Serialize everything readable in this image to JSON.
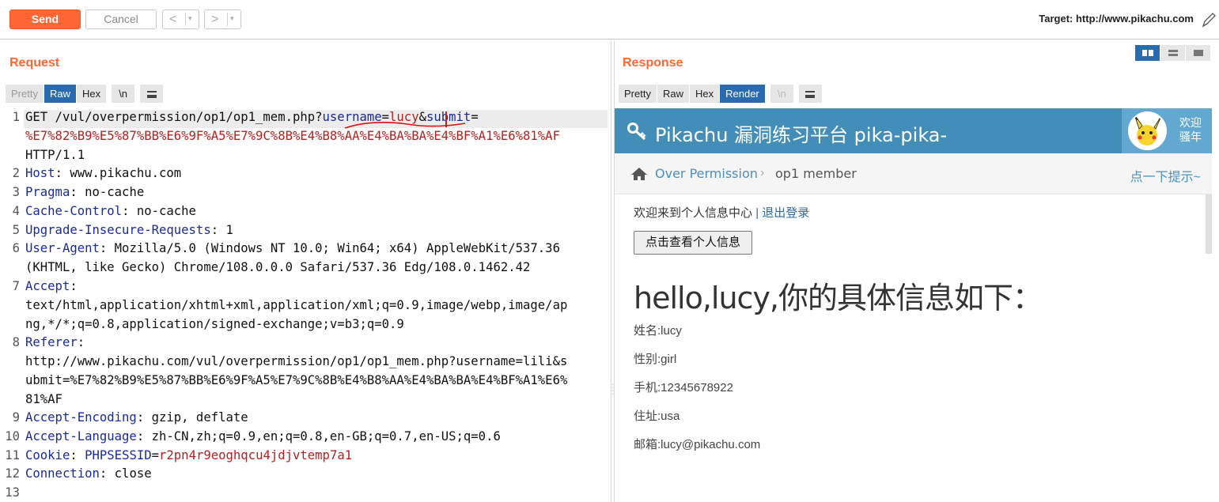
{
  "toolbar": {
    "send_label": "Send",
    "cancel_label": "Cancel",
    "back_label": "<",
    "forward_label": ">",
    "dropdown_glyph": "▾",
    "target_label": "Target: http://www.pikachu.com"
  },
  "request": {
    "title": "Request",
    "tabs": [
      "Pretty",
      "Raw",
      "Hex",
      "\\n"
    ],
    "active_tab": "Raw",
    "line_numbers": [
      "1",
      "2",
      "3",
      "4",
      "5",
      "6",
      "7",
      "8",
      "9",
      "10",
      "11",
      "12",
      "13"
    ],
    "lines": {
      "l1_method_path": "GET /vul/overpermission/op1/op1_mem.php?",
      "l1_username_key": "username",
      "l1_eq1": "=",
      "l1_username_val": "lucy",
      "l1_amp": "&",
      "l1_submit_key": "submit",
      "l1_eq2": "=",
      "l1_encoded": "%E7%82%B9%E5%87%BB%E6%9F%A5%E7%9C%8B%E4%B8%AA%E4%BA%BA%E4%BF%A1%E6%81%AF",
      "l1_version": "HTTP/1.1",
      "l2_key": "Host",
      "l2_val": ": www.pikachu.com",
      "l3_key": "Pragma",
      "l3_val": ": no-cache",
      "l4_key": "Cache-Control",
      "l4_val": ": no-cache",
      "l5_key": "Upgrade-Insecure-Requests",
      "l5_val": ": 1",
      "l6_key": "User-Agent",
      "l6_val": ": Mozilla/5.0 (Windows NT 10.0; Win64; x64) AppleWebKit/537.36",
      "l6_cont": "(KHTML, like Gecko) Chrome/108.0.0.0 Safari/537.36 Edg/108.0.1462.42",
      "l7_key": "Accept",
      "l7_val": ":",
      "l7_cont1": "text/html,application/xhtml+xml,application/xml;q=0.9,image/webp,image/ap",
      "l7_cont2": "ng,*/*;q=0.8,application/signed-exchange;v=b3;q=0.9",
      "l8_key": "Referer",
      "l8_val": ":",
      "l8_cont1": "http://www.pikachu.com/vul/overpermission/op1/op1_mem.php?username=lili&s",
      "l8_cont2": "ubmit=%E7%82%B9%E5%87%BB%E6%9F%A5%E7%9C%8B%E4%B8%AA%E4%BA%BA%E4%BF%A1%E6%",
      "l8_cont3": "81%AF",
      "l9_key": "Accept-Encoding",
      "l9_val": ": gzip, deflate",
      "l10_key": "Accept-Language",
      "l10_val": ": zh-CN,zh;q=0.9,en;q=0.8,en-GB;q=0.7,en-US;q=0.6",
      "l11_key": "Cookie",
      "l11_sep": ": ",
      "l11_name": "PHPSESSID",
      "l11_eq": "=",
      "l11_value": "r2pn4r9eoghqcu4jdjvtemp7a1",
      "l12_key": "Connection",
      "l12_val": ": close"
    }
  },
  "response": {
    "title": "Response",
    "tabs": [
      "Pretty",
      "Raw",
      "Hex",
      "Render",
      "\\n"
    ],
    "active_tab": "Render",
    "rendered": {
      "site_title": "Pikachu 漏洞练习平台 pika-pika-",
      "welcome": "欢迎骚年",
      "breadcrumb_link": "Over Permission",
      "breadcrumb_current": "op1 member",
      "hint_link": "点一下提示~",
      "welcome_line": "欢迎来到个人信息中心",
      "divider_bar": "|",
      "logout_link": "退出登录",
      "view_button": "点击查看个人信息",
      "hello": "hello,lucy,你的具体信息如下：",
      "fields": [
        "姓名:lucy",
        "性别:girl",
        "手机:12345678922",
        "住址:usa",
        "邮箱:lucy@pikachu.com"
      ]
    }
  },
  "colors": {
    "accent_orange": "#ff6633",
    "active_tab_blue": "#2a6ab1",
    "header_blue": "#438eb9",
    "encoded_red": "#b22222",
    "header_key_blue": "#1a2a9a"
  }
}
